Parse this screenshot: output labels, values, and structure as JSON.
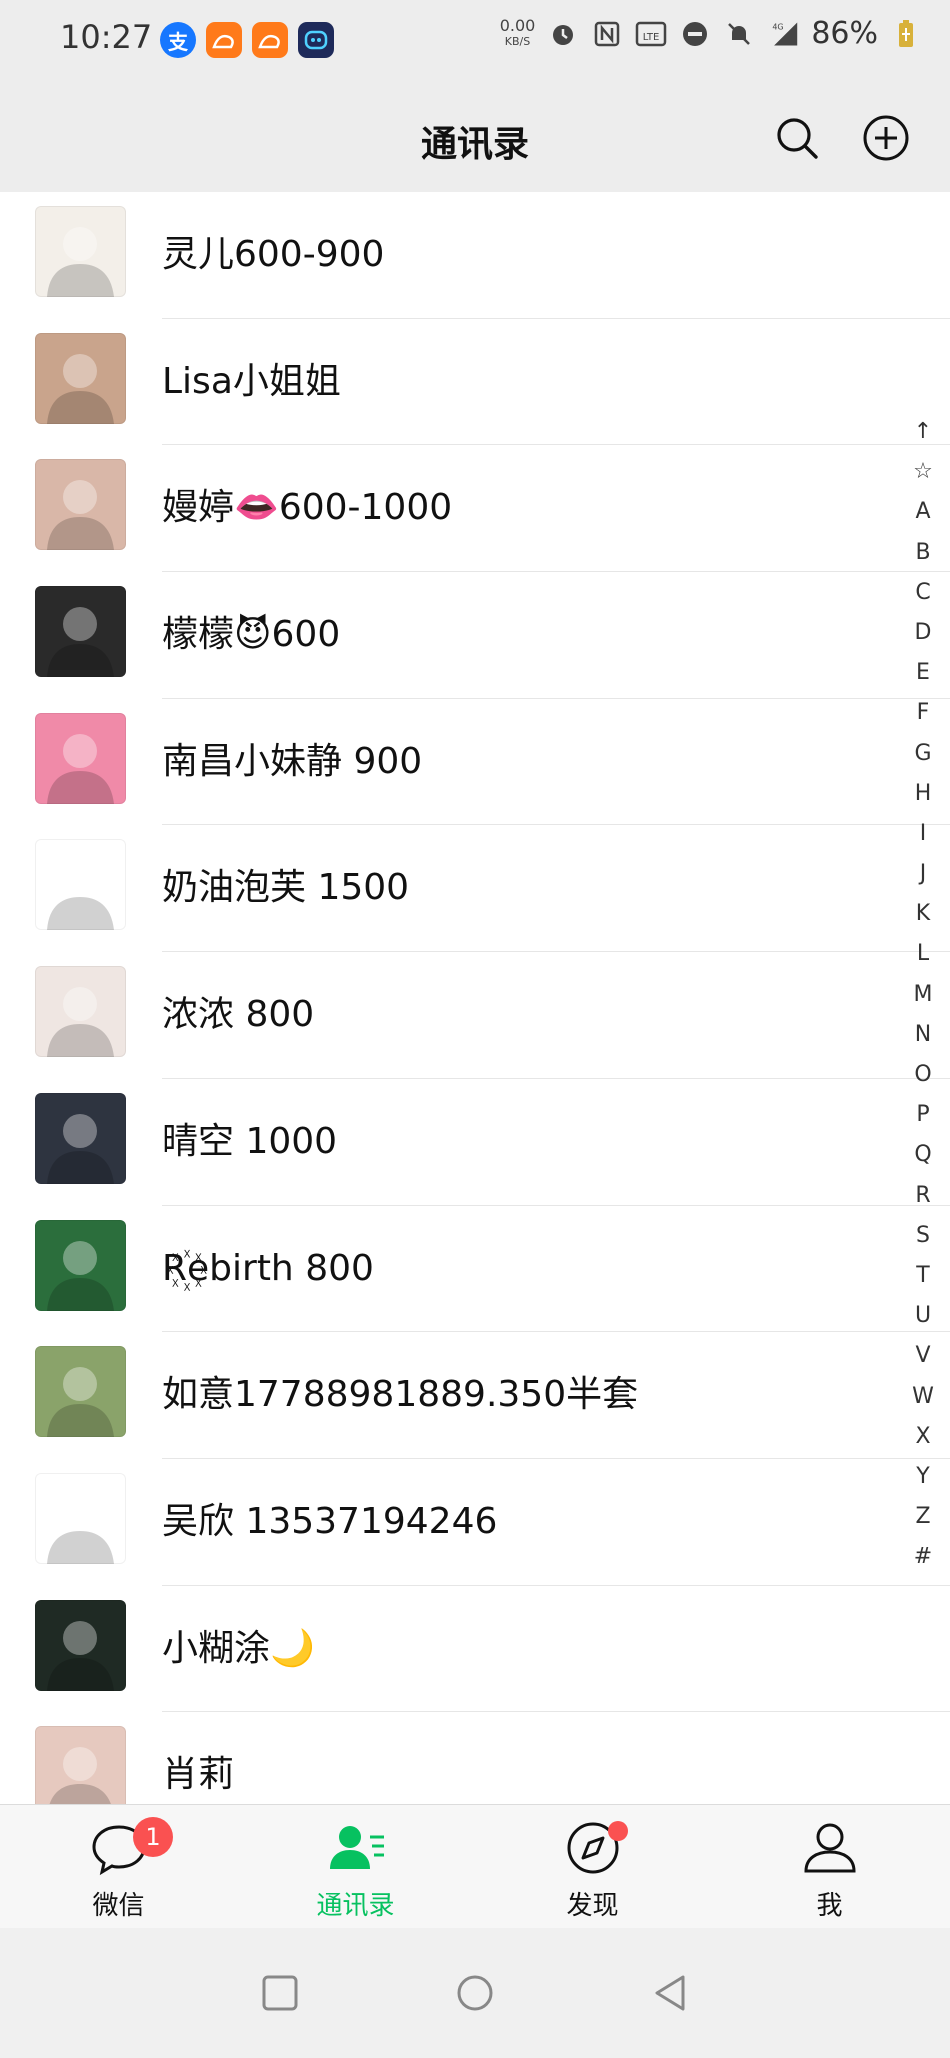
{
  "status_bar": {
    "time": "10:27",
    "net_speed": "0.00",
    "net_unit": "KB/S",
    "battery": "86%"
  },
  "header": {
    "title": "通讯录"
  },
  "contacts": [
    {
      "name": "灵儿600-900",
      "avatar_color": "#f3efe9"
    },
    {
      "name": "Lisa小姐姐",
      "avatar_color": "#c9a48c"
    },
    {
      "name": "嫚婷👄600-1000",
      "avatar_color": "#d9b7a8"
    },
    {
      "name": "檬檬😈600",
      "avatar_color": "#2a2a2a"
    },
    {
      "name": "南昌小妹静 900",
      "avatar_color": "#f08aa8"
    },
    {
      "name": "奶油泡芙  1500",
      "avatar_color": "#ffffff"
    },
    {
      "name": "浓浓 800",
      "avatar_color": "#efe6e2"
    },
    {
      "name": "晴空 1000",
      "avatar_color": "#2e3440"
    },
    {
      "name": "R꙰ebirth  800",
      "avatar_color": "#2b6e3c"
    },
    {
      "name": "如意17788981889.350半套",
      "avatar_color": "#8aa36a"
    },
    {
      "name": "吴欣 13537194246",
      "avatar_color": "#ffffff"
    },
    {
      "name": "小糊涂🌙",
      "avatar_color": "#1f2a24"
    },
    {
      "name": "肖莉",
      "avatar_color": "#e6c9bf"
    }
  ],
  "index_letters": [
    "↑",
    "☆",
    "A",
    "B",
    "C",
    "D",
    "E",
    "F",
    "G",
    "H",
    "I",
    "J",
    "K",
    "L",
    "M",
    "N",
    "O",
    "P",
    "Q",
    "R",
    "S",
    "T",
    "U",
    "V",
    "W",
    "X",
    "Y",
    "Z",
    "#"
  ],
  "tabs": [
    {
      "label": "微信",
      "badge": "1"
    },
    {
      "label": "通讯录"
    },
    {
      "label": "发现"
    },
    {
      "label": "我"
    }
  ],
  "colors": {
    "accent": "#07c160",
    "badge": "#fa5151"
  }
}
